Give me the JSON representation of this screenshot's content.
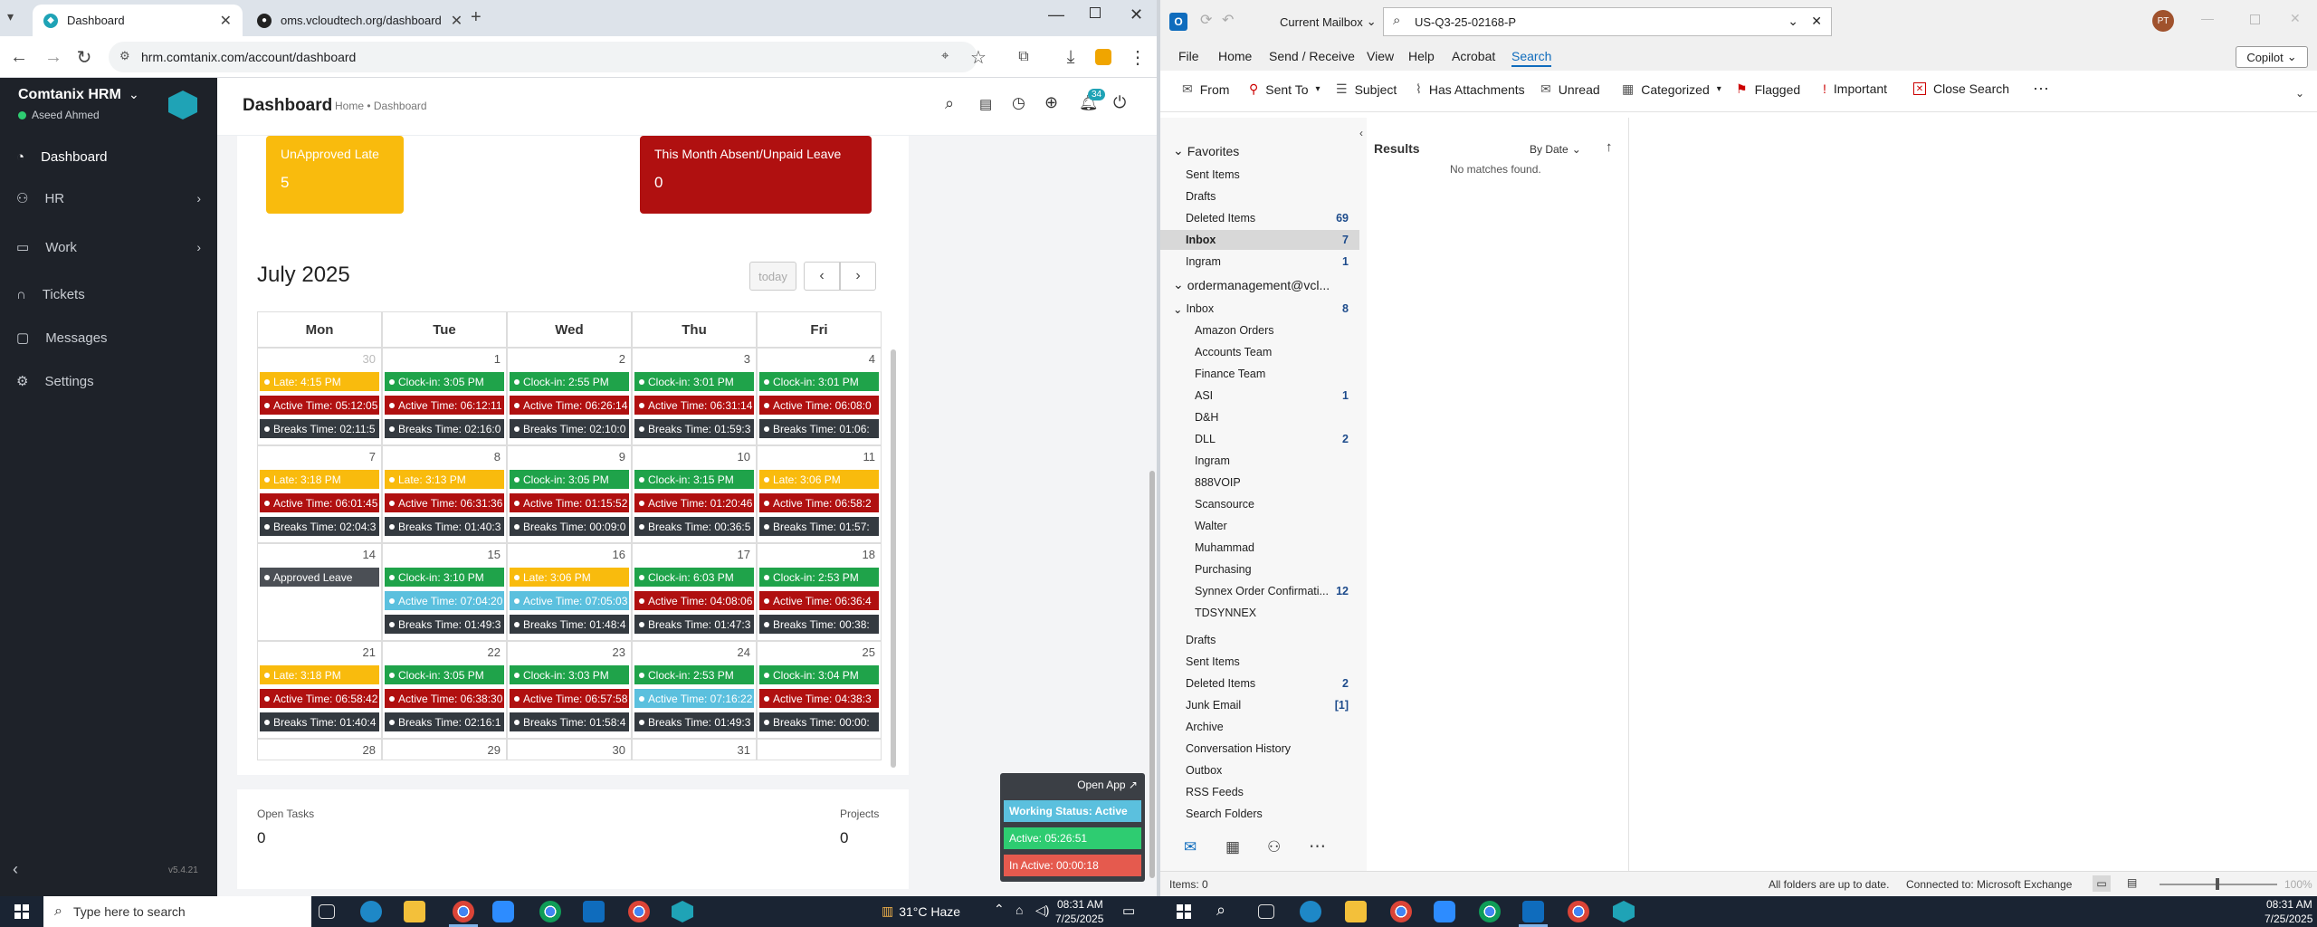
{
  "chrome": {
    "tabs": [
      {
        "title": "Dashboard",
        "icon": "hrm-favicon",
        "active": true
      },
      {
        "title": "oms.vcloudtech.org/dashboard",
        "icon": "github-favicon",
        "active": false
      }
    ],
    "url": "hrm.comtanix.com/account/dashboard"
  },
  "hrm": {
    "brand": "Comtanix HRM",
    "user": "Aseed Ahmed",
    "version": "v5.4.21",
    "nav": [
      {
        "label": "Dashboard",
        "icon": "gauge-icon",
        "chevron": false
      },
      {
        "label": "HR",
        "icon": "users-icon",
        "chevron": true
      },
      {
        "label": "Work",
        "icon": "briefcase-icon",
        "chevron": true
      },
      {
        "label": "Tickets",
        "icon": "headset-icon",
        "chevron": false
      },
      {
        "label": "Messages",
        "icon": "message-icon",
        "chevron": false
      },
      {
        "label": "Settings",
        "icon": "gear-icon",
        "chevron": false
      }
    ],
    "header": {
      "title": "Dashboard",
      "breadcrumb": "Home • Dashboard",
      "notif_count": "34"
    },
    "stats": [
      {
        "label": "UnApproved Late",
        "value": "5"
      },
      {
        "label": "This Month Absent/Unpaid Leave",
        "value": "0"
      }
    ],
    "calendar": {
      "title": "July 2025",
      "today_btn": "today",
      "days": [
        "Mon",
        "Tue",
        "Wed",
        "Thu",
        "Fri"
      ],
      "weeks": [
        {
          "nums": [
            "30",
            "1",
            "2",
            "3",
            "4"
          ],
          "muted": [
            true,
            false,
            false,
            false,
            false
          ],
          "cells": [
            [
              [
                "y",
                "Late: 4:15 PM"
              ],
              [
                "r",
                "Active Time: 05:12:05"
              ],
              [
                "k",
                "Breaks Time: 02:11:5"
              ]
            ],
            [
              [
                "g",
                "Clock-in: 3:05 PM"
              ],
              [
                "r",
                "Active Time: 06:12:11"
              ],
              [
                "k",
                "Breaks Time: 02:16:0"
              ]
            ],
            [
              [
                "g",
                "Clock-in: 2:55 PM"
              ],
              [
                "r",
                "Active Time: 06:26:14"
              ],
              [
                "k",
                "Breaks Time: 02:10:0"
              ]
            ],
            [
              [
                "g",
                "Clock-in: 3:01 PM"
              ],
              [
                "r",
                "Active Time: 06:31:14"
              ],
              [
                "k",
                "Breaks Time: 01:59:3"
              ]
            ],
            [
              [
                "g",
                "Clock-in: 3:01 PM"
              ],
              [
                "r",
                "Active Time: 06:08:0"
              ],
              [
                "k",
                "Breaks Time: 01:06:"
              ]
            ]
          ]
        },
        {
          "nums": [
            "7",
            "8",
            "9",
            "10",
            "11"
          ],
          "muted": [
            false,
            false,
            false,
            false,
            false
          ],
          "cells": [
            [
              [
                "y",
                "Late: 3:18 PM"
              ],
              [
                "r",
                "Active Time: 06:01:45"
              ],
              [
                "k",
                "Breaks Time: 02:04:3"
              ]
            ],
            [
              [
                "y",
                "Late: 3:13 PM"
              ],
              [
                "r",
                "Active Time: 06:31:36"
              ],
              [
                "k",
                "Breaks Time: 01:40:3"
              ]
            ],
            [
              [
                "g",
                "Clock-in: 3:05 PM"
              ],
              [
                "r",
                "Active Time: 01:15:52"
              ],
              [
                "k",
                "Breaks Time: 00:09:0"
              ]
            ],
            [
              [
                "g",
                "Clock-in: 3:15 PM"
              ],
              [
                "r",
                "Active Time: 01:20:46"
              ],
              [
                "k",
                "Breaks Time: 00:36:5"
              ]
            ],
            [
              [
                "y",
                "Late: 3:06 PM"
              ],
              [
                "r",
                "Active Time: 06:58:2"
              ],
              [
                "k",
                "Breaks Time: 01:57:"
              ]
            ]
          ]
        },
        {
          "nums": [
            "14",
            "15",
            "16",
            "17",
            "18"
          ],
          "muted": [
            false,
            false,
            false,
            false,
            false
          ],
          "cells": [
            [
              [
                "gr",
                "Approved Leave"
              ]
            ],
            [
              [
                "g",
                "Clock-in: 3:10 PM"
              ],
              [
                "t",
                "Active Time: 07:04:20"
              ],
              [
                "k",
                "Breaks Time: 01:49:3"
              ]
            ],
            [
              [
                "y",
                "Late: 3:06 PM"
              ],
              [
                "t",
                "Active Time: 07:05:03"
              ],
              [
                "k",
                "Breaks Time: 01:48:4"
              ]
            ],
            [
              [
                "g",
                "Clock-in: 6:03 PM"
              ],
              [
                "r",
                "Active Time: 04:08:06"
              ],
              [
                "k",
                "Breaks Time: 01:47:3"
              ]
            ],
            [
              [
                "g",
                "Clock-in: 2:53 PM"
              ],
              [
                "r",
                "Active Time: 06:36:4"
              ],
              [
                "k",
                "Breaks Time: 00:38:"
              ]
            ]
          ]
        },
        {
          "nums": [
            "21",
            "22",
            "23",
            "24",
            "25"
          ],
          "muted": [
            false,
            false,
            false,
            false,
            false
          ],
          "cells": [
            [
              [
                "y",
                "Late: 3:18 PM"
              ],
              [
                "r",
                "Active Time: 06:58:42"
              ],
              [
                "k",
                "Breaks Time: 01:40:4"
              ]
            ],
            [
              [
                "g",
                "Clock-in: 3:05 PM"
              ],
              [
                "r",
                "Active Time: 06:38:30"
              ],
              [
                "k",
                "Breaks Time: 02:16:1"
              ]
            ],
            [
              [
                "g",
                "Clock-in: 3:03 PM"
              ],
              [
                "r",
                "Active Time: 06:57:58"
              ],
              [
                "k",
                "Breaks Time: 01:58:4"
              ]
            ],
            [
              [
                "g",
                "Clock-in: 2:53 PM"
              ],
              [
                "t",
                "Active Time: 07:16:22"
              ],
              [
                "k",
                "Breaks Time: 01:49:3"
              ]
            ],
            [
              [
                "g",
                "Clock-in: 3:04 PM"
              ],
              [
                "r",
                "Active Time: 04:38:3"
              ],
              [
                "k",
                "Breaks Time: 00:00:"
              ]
            ]
          ]
        },
        {
          "nums": [
            "28",
            "29",
            "30",
            "31",
            ""
          ],
          "muted": [
            false,
            false,
            false,
            false,
            false
          ],
          "cells": [
            [],
            [],
            [],
            [],
            []
          ]
        }
      ]
    },
    "bottom": {
      "open_tasks_label": "Open Tasks",
      "open_tasks_value": "0",
      "projects_label": "Projects",
      "projects_value": "0"
    },
    "widget": {
      "open_app": "Open App ↗",
      "status": "Working Status: Active",
      "active": "Active: 05:26:51",
      "inactive": "In Active: 00:00:18"
    }
  },
  "outlook": {
    "mailbox_scope": "Current Mailbox",
    "search_query": "US-Q3-25-02168-P",
    "avatar": "PT",
    "copilot": "Copilot",
    "menu": [
      "File",
      "Home",
      "Send / Receive",
      "View",
      "Help",
      "Acrobat",
      "Search"
    ],
    "ribbon": [
      "From",
      "Sent To",
      "Subject",
      "Has Attachments",
      "Unread",
      "Categorized",
      "Flagged",
      "Important",
      "Close Search"
    ],
    "favorites_label": "Favorites",
    "favorites": [
      {
        "name": "Sent Items",
        "count": ""
      },
      {
        "name": "Drafts",
        "count": ""
      },
      {
        "name": "Deleted Items",
        "count": "69"
      },
      {
        "name": "Inbox",
        "count": "7"
      },
      {
        "name": "Ingram",
        "count": "1"
      }
    ],
    "account": "ordermanagement@vcl...",
    "inbox_label": "Inbox",
    "inbox_count": "8",
    "inbox_children": [
      {
        "name": "Amazon Orders",
        "count": ""
      },
      {
        "name": "Accounts Team",
        "count": ""
      },
      {
        "name": "Finance Team",
        "count": ""
      },
      {
        "name": "ASI",
        "count": "1"
      },
      {
        "name": "D&H",
        "count": ""
      },
      {
        "name": "DLL",
        "count": "2"
      },
      {
        "name": "Ingram",
        "count": ""
      },
      {
        "name": "888VOIP",
        "count": ""
      },
      {
        "name": "Scansource",
        "count": ""
      },
      {
        "name": "Walter",
        "count": ""
      },
      {
        "name": "Muhammad",
        "count": ""
      },
      {
        "name": "Purchasing",
        "count": ""
      },
      {
        "name": "Synnex Order Confirmati...",
        "count": "12"
      },
      {
        "name": "TDSYNNEX",
        "count": ""
      }
    ],
    "other_folders": [
      {
        "name": "Drafts",
        "count": ""
      },
      {
        "name": "Sent Items",
        "count": ""
      },
      {
        "name": "Deleted Items",
        "count": "2"
      },
      {
        "name": "Junk Email",
        "count": "[1]"
      },
      {
        "name": "Archive",
        "count": ""
      },
      {
        "name": "Conversation History",
        "count": ""
      },
      {
        "name": "Outbox",
        "count": ""
      },
      {
        "name": "RSS Feeds",
        "count": ""
      },
      {
        "name": "Search Folders",
        "count": ""
      }
    ],
    "results_title": "Results",
    "sort": "By Date",
    "no_matches": "No matches found.",
    "status_items": "Items: 0",
    "status_sync": "All folders are up to date.",
    "status_conn": "Connected to: Microsoft Exchange",
    "zoom": "100%"
  },
  "taskbar": {
    "search_placeholder": "Type here to search",
    "weather": "31°C  Haze",
    "left_time": "08:31 AM",
    "left_date": "7/25/2025",
    "right_time": "08:31 AM",
    "right_date": "7/25/2025"
  }
}
